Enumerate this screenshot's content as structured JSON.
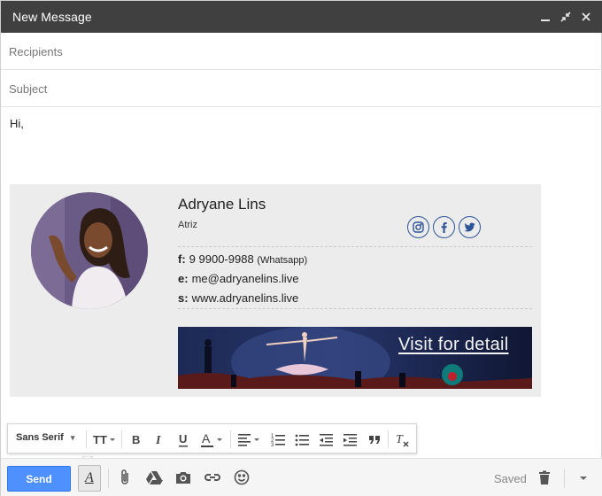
{
  "window": {
    "title": "New Message",
    "controls": [
      "minimize-icon",
      "exit-fullscreen-icon",
      "close-icon"
    ]
  },
  "compose": {
    "recipients_placeholder": "Recipients",
    "subject_placeholder": "Subject",
    "body_greeting": "Hi,"
  },
  "signature": {
    "name": "Adryane Lins",
    "role": "Atriz",
    "social": [
      "instagram-icon",
      "facebook-icon",
      "twitter-icon"
    ],
    "phone": {
      "label": "f:",
      "value": "9 9900-9988",
      "note": "(Whatsapp)"
    },
    "email": {
      "label": "e:",
      "value": "me@adryanelins.live"
    },
    "site": {
      "label": "s:",
      "value": "www.adryanelins.live"
    },
    "banner_text": "Visit for detail",
    "accent_color": "#2f5597"
  },
  "formatting": {
    "font_family": "Sans Serif",
    "tools": [
      "text-size-icon",
      "bold-icon",
      "italic-icon",
      "underline-icon",
      "text-color-icon",
      "align-icon",
      "numbered-list-icon",
      "bulleted-list-icon",
      "indent-less-icon",
      "indent-more-icon",
      "quote-icon",
      "remove-formatting-icon"
    ]
  },
  "bottom_bar": {
    "send_label": "Send",
    "send_color": "#4d90fe",
    "tools": [
      "formatting-options-icon",
      "attach-icon",
      "drive-icon",
      "photo-icon",
      "link-icon",
      "emoji-icon"
    ],
    "status": "Saved"
  }
}
